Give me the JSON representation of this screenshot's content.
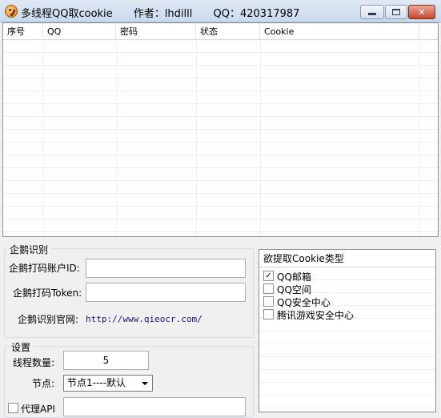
{
  "window": {
    "title": "多线程QQ取cookie",
    "author": "作者：lhdilll",
    "qq": "QQ：420317987"
  },
  "grid": {
    "columns": [
      "序号",
      "QQ",
      "密码",
      "状态",
      "Cookie"
    ]
  },
  "captcha_group": {
    "title": "企鹅识别",
    "account_label": "企鹅打码账户ID:",
    "account_value": "",
    "token_label": "企鹅打码Token:",
    "token_value": "",
    "site_label": "企鹅识别官网:",
    "site_url": "http://www.qieocr.com/"
  },
  "settings_group": {
    "title": "设置",
    "threads_label": "线程数量:",
    "threads_value": "5",
    "node_label": "节点:",
    "node_value": "节点1----默认",
    "proxy_label": "代理API",
    "proxy_checked": false,
    "proxy_value": ""
  },
  "cookie_types": {
    "title": "欲提取Cookie类型",
    "items": [
      {
        "label": "QQ邮箱",
        "checked": true
      },
      {
        "label": "QQ空间",
        "checked": false
      },
      {
        "label": "QQ安全中心",
        "checked": false
      },
      {
        "label": "腾讯游戏安全中心",
        "checked": false
      }
    ]
  }
}
